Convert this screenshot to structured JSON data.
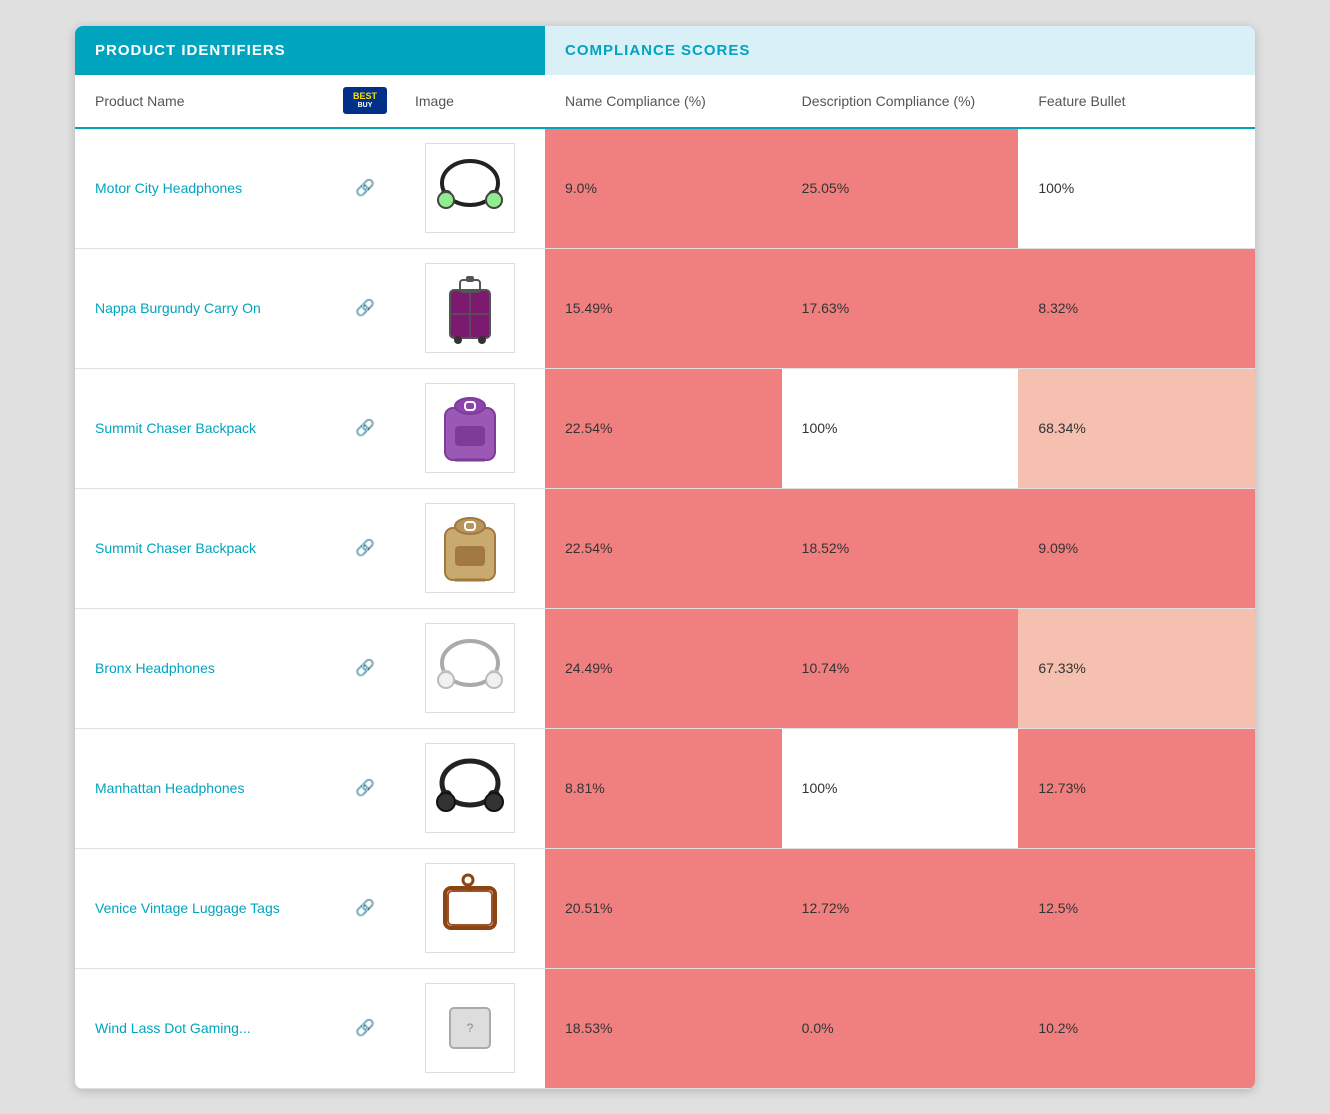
{
  "headers": {
    "product_identifiers": "PRODUCT IDENTIFIERS",
    "compliance_scores": "COMPLIANCE SCORES"
  },
  "subheaders": {
    "product_name": "Product Name",
    "image": "Image",
    "name_compliance": "Name Compliance (%)",
    "description_compliance": "Description Compliance (%)",
    "feature_bullet": "Feature Bullet"
  },
  "rows": [
    {
      "id": 1,
      "name": "Motor City Headphones",
      "name_compliance": "9.0%",
      "description_compliance": "25.05%",
      "feature_bullet": "100%",
      "name_color": "red",
      "desc_color": "red",
      "feat_color": "white",
      "img_type": "headphones_green"
    },
    {
      "id": 2,
      "name": "Nappa Burgundy Carry On",
      "name_compliance": "15.49%",
      "description_compliance": "17.63%",
      "feature_bullet": "8.32%",
      "name_color": "red",
      "desc_color": "red",
      "feat_color": "red",
      "img_type": "luggage"
    },
    {
      "id": 3,
      "name": "Summit Chaser Backpack",
      "name_compliance": "22.54%",
      "description_compliance": "100%",
      "feature_bullet": "68.34%",
      "name_color": "red",
      "desc_color": "white",
      "feat_color": "peach",
      "img_type": "backpack_purple"
    },
    {
      "id": 4,
      "name": "Summit Chaser Backpack",
      "name_compliance": "22.54%",
      "description_compliance": "18.52%",
      "feature_bullet": "9.09%",
      "name_color": "red",
      "desc_color": "red",
      "feat_color": "red",
      "img_type": "backpack_tan"
    },
    {
      "id": 5,
      "name": "Bronx Headphones",
      "name_compliance": "24.49%",
      "description_compliance": "10.74%",
      "feature_bullet": "67.33%",
      "name_color": "red",
      "desc_color": "red",
      "feat_color": "peach",
      "img_type": "headphones_white"
    },
    {
      "id": 6,
      "name": "Manhattan Headphones",
      "name_compliance": "8.81%",
      "description_compliance": "100%",
      "feature_bullet": "12.73%",
      "name_color": "red",
      "desc_color": "white",
      "feat_color": "red",
      "img_type": "headphones_black"
    },
    {
      "id": 7,
      "name": "Venice Vintage Luggage Tags",
      "name_compliance": "20.51%",
      "description_compliance": "12.72%",
      "feature_bullet": "12.5%",
      "name_color": "red",
      "desc_color": "red",
      "feat_color": "red",
      "img_type": "luggage_tag"
    },
    {
      "id": 8,
      "name": "Wind Lass Dot Gaming...",
      "name_compliance": "18.53%",
      "description_compliance": "0.0%",
      "feature_bullet": "10.2%",
      "name_color": "red",
      "desc_color": "red",
      "feat_color": "red",
      "img_type": "generic"
    }
  ]
}
